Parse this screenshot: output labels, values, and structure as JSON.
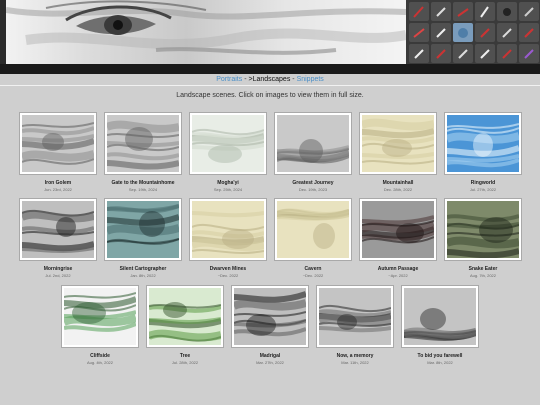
{
  "breadcrumb": {
    "items": [
      {
        "label": "Portraits",
        "link": true
      },
      {
        "label": " - ",
        "link": false
      },
      {
        "label": ">Landscapes",
        "link": false
      },
      {
        "label": " - ",
        "link": false
      },
      {
        "label": "Snippets",
        "link": true
      }
    ]
  },
  "intro": "Landscape scenes. Click on images to view them in full size.",
  "gallery": {
    "rows": [
      [
        {
          "title": "Iron Golem",
          "date": "Jun. 23rd, 2022",
          "palette": "gray"
        },
        {
          "title": "Gate to the Mountainhome",
          "date": "Sep. 19th, 2024",
          "palette": "gray"
        },
        {
          "title": "Mogha'yi",
          "date": "Sep. 25th, 2024",
          "palette": "pale"
        },
        {
          "title": "Greatest Journey",
          "date": "Dec. 19th, 2023",
          "palette": "gray"
        },
        {
          "title": "Mountainhall",
          "date": "Dec. 28th, 2022",
          "palette": "cream"
        },
        {
          "title": "Ringworld",
          "date": "Jul. 27th, 2022",
          "palette": "sky"
        }
      ],
      [
        {
          "title": "Morningrise",
          "date": "Jul. 2nd, 2022",
          "palette": "dark"
        },
        {
          "title": "Silent Cartographer",
          "date": "Jan. 8th, 2022",
          "palette": "teal"
        },
        {
          "title": "Dwarven Mines",
          "date": "~Dec. 2022",
          "palette": "cream"
        },
        {
          "title": "Cavern",
          "date": "~Dec. 2022",
          "palette": "cream"
        },
        {
          "title": "Autumn Passage",
          "date": "~Apr. 2022",
          "palette": "darkred"
        },
        {
          "title": "Snake Eater",
          "date": "Aug. 7th, 2022",
          "palette": "forest"
        }
      ],
      [
        {
          "title": "Cliffside",
          "date": "Aug. 4th, 2022",
          "palette": "green"
        },
        {
          "title": "Tree",
          "date": "Jul. 28th, 2022",
          "palette": "greentree"
        },
        {
          "title": "Madrigal",
          "date": "Mar. 27th, 2022",
          "palette": "dark"
        },
        {
          "title": "Now, a memory",
          "date": "Mar. 11th, 2022",
          "palette": "darkgray"
        },
        {
          "title": "To bid you farewell",
          "date": "Mar. 8th, 2022",
          "palette": "darkgray"
        }
      ]
    ]
  },
  "colors": {
    "background": "#cfcfcf",
    "link": "#4a8fc8",
    "banner_dark": "#1a1a1a"
  }
}
